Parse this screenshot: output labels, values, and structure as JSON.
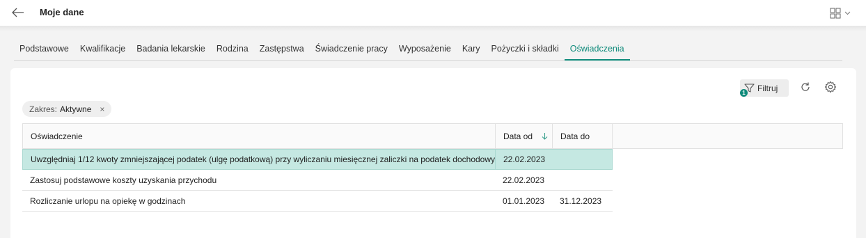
{
  "header": {
    "title": "Moje dane"
  },
  "tabs": [
    {
      "label": "Podstawowe"
    },
    {
      "label": "Kwalifikacje"
    },
    {
      "label": "Badania lekarskie"
    },
    {
      "label": "Rodzina"
    },
    {
      "label": "Zastępstwa"
    },
    {
      "label": "Świadczenie pracy"
    },
    {
      "label": "Wyposażenie"
    },
    {
      "label": "Kary"
    },
    {
      "label": "Pożyczki i składki"
    },
    {
      "label": "Oświadczenia"
    }
  ],
  "active_tab": "Oświadczenia",
  "toolbar": {
    "filter_label": "Filtruj",
    "filter_count": "1"
  },
  "chip": {
    "key": "Zakres:",
    "value": "Aktywne",
    "remove": "×"
  },
  "table": {
    "columns": [
      "Oświadczenie",
      "Data od",
      "Data do"
    ],
    "sort_column": "Data od",
    "sort_direction": "descending",
    "rows": [
      {
        "oswiadczenie": "Uwzględniaj 1/12 kwoty zmniejszającej podatek (ulgę podatkową) przy wyliczaniu miesięcznej zaliczki na podatek dochodowy",
        "data_od": "22.02.2023",
        "data_do": "",
        "selected": true
      },
      {
        "oswiadczenie": "Zastosuj podstawowe koszty uzyskania przychodu",
        "data_od": "22.02.2023",
        "data_do": ""
      },
      {
        "oswiadczenie": "Rozliczanie urlopu na opiekę w godzinach",
        "data_od": "01.01.2023",
        "data_do": "31.12.2023"
      }
    ]
  },
  "colors": {
    "accent": "#0e8a7a",
    "selected_row": "#c5e8e2"
  }
}
